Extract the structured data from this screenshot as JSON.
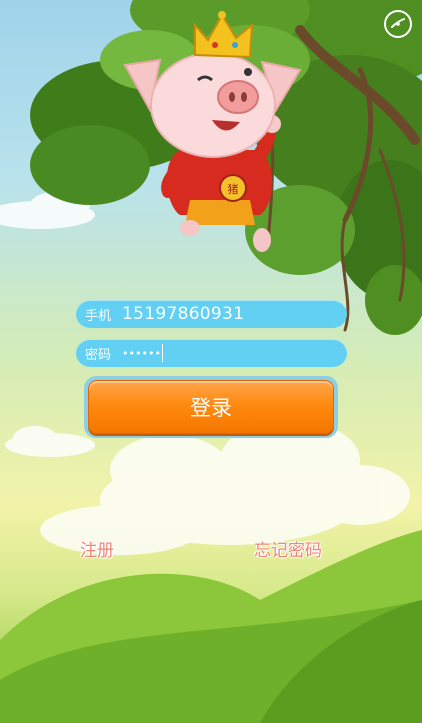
{
  "form": {
    "phone_label": "手机",
    "phone_value": "15197860931",
    "password_label": "密码",
    "password_value": "••••••"
  },
  "buttons": {
    "login_label": "登录"
  },
  "links": {
    "register_label": "注册",
    "forgot_label": "忘记密码"
  },
  "badge": {
    "pig_chest": "猪"
  },
  "colors": {
    "field": "#62d0f3",
    "login_button": "#ff8a10",
    "link_text": "#f0837a"
  },
  "icons": {
    "sound": "sound-toggle-icon"
  }
}
